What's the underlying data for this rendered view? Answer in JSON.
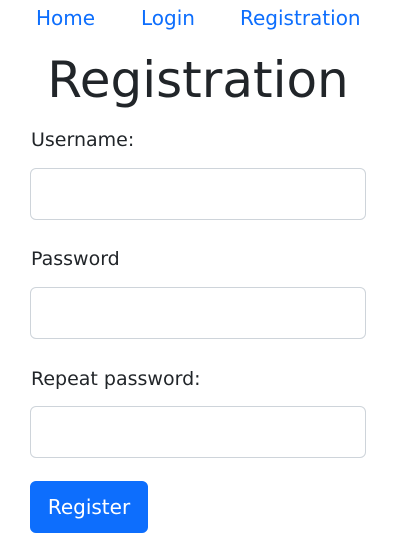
{
  "nav": {
    "items": [
      {
        "label": "Home"
      },
      {
        "label": "Login"
      },
      {
        "label": "Registration"
      }
    ]
  },
  "page": {
    "title": "Registration"
  },
  "form": {
    "username_label": "Username:",
    "username_value": "",
    "password_label": "Password",
    "password_value": "",
    "repeat_password_label": "Repeat password:",
    "repeat_password_value": "",
    "submit_label": "Register"
  },
  "colors": {
    "link": "#0d6efd",
    "primary_button": "#0d6efd",
    "text": "#212529",
    "input_border": "#ced4da"
  }
}
